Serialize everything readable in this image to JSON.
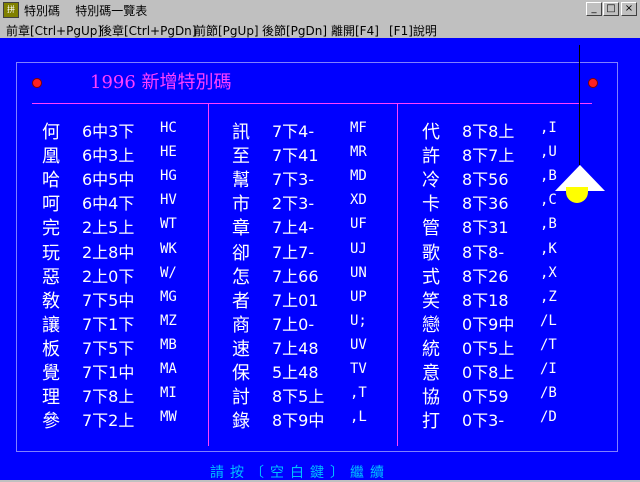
{
  "window": {
    "title": "特別碼    特別碼一覽表",
    "icon": "app-icon",
    "buttons": [
      "_",
      "□",
      "×"
    ]
  },
  "menu": [
    "前章[Ctrl+PgUp]",
    "後章[Ctrl+PgDn]",
    "前節[PgUp]",
    "後節[PgDn]",
    "離開[F4]",
    "[F1]說明"
  ],
  "page": {
    "heading": "1996 新增特別碼",
    "footer": "請按〔空白鍵〕繼續"
  },
  "columns": [
    [
      {
        "char": "何",
        "pos": "6中3下",
        "code": "HC"
      },
      {
        "char": "凰",
        "pos": "6中3上",
        "code": "HE"
      },
      {
        "char": "哈",
        "pos": "6中5中",
        "code": "HG"
      },
      {
        "char": "呵",
        "pos": "6中4下",
        "code": "HV"
      },
      {
        "char": "完",
        "pos": "2上5上",
        "code": "WT"
      },
      {
        "char": "玩",
        "pos": "2上8中",
        "code": "WK"
      },
      {
        "char": "惡",
        "pos": "2上0下",
        "code": "W/"
      },
      {
        "char": "敎",
        "pos": "7下5中",
        "code": "MG"
      },
      {
        "char": "讓",
        "pos": "7下1下",
        "code": "MZ"
      },
      {
        "char": "板",
        "pos": "7下5下",
        "code": "MB"
      },
      {
        "char": "覺",
        "pos": "7下1中",
        "code": "MA"
      },
      {
        "char": "理",
        "pos": "7下8上",
        "code": "MI"
      },
      {
        "char": "參",
        "pos": "7下2上",
        "code": "MW"
      }
    ],
    [
      {
        "char": "訊",
        "pos": "7下4-",
        "code": "MF"
      },
      {
        "char": "至",
        "pos": "7下41",
        "code": "MR"
      },
      {
        "char": "幫",
        "pos": "7下3-",
        "code": "MD"
      },
      {
        "char": "市",
        "pos": "2下3-",
        "code": "XD"
      },
      {
        "char": "章",
        "pos": "7上4-",
        "code": "UF"
      },
      {
        "char": "卻",
        "pos": "7上7-",
        "code": "UJ"
      },
      {
        "char": "怎",
        "pos": "7上66",
        "code": "UN"
      },
      {
        "char": "者",
        "pos": "7上01",
        "code": "UP"
      },
      {
        "char": "商",
        "pos": "7上0-",
        "code": "U;"
      },
      {
        "char": "速",
        "pos": "7上48",
        "code": "UV"
      },
      {
        "char": "保",
        "pos": "5上48",
        "code": "TV"
      },
      {
        "char": "討",
        "pos": "8下5上",
        "code": ",T"
      },
      {
        "char": "錄",
        "pos": "8下9中",
        "code": ",L"
      }
    ],
    [
      {
        "char": "代",
        "pos": "8下8上",
        "code": ",I"
      },
      {
        "char": "許",
        "pos": "8下7上",
        "code": ",U"
      },
      {
        "char": "冷",
        "pos": "8下56",
        "code": ",B"
      },
      {
        "char": "卡",
        "pos": "8下36",
        "code": ",C"
      },
      {
        "char": "管",
        "pos": "8下31",
        "code": ",B"
      },
      {
        "char": "歌",
        "pos": "8下8-",
        "code": ",K"
      },
      {
        "char": "式",
        "pos": "8下26",
        "code": ",X"
      },
      {
        "char": "笑",
        "pos": "8下18",
        "code": ",Z"
      },
      {
        "char": "戀",
        "pos": "0下9中",
        "code": "/L"
      },
      {
        "char": "統",
        "pos": "0下5上",
        "code": "/T"
      },
      {
        "char": "意",
        "pos": "0下8上",
        "code": "/I"
      },
      {
        "char": "協",
        "pos": "0下59",
        "code": "/B"
      },
      {
        "char": "打",
        "pos": "0下3-",
        "code": "/D"
      }
    ]
  ],
  "colors": {
    "background": "#0000ff",
    "heading": "#ff40ff",
    "text": "#ffffff",
    "footer": "#00c0ff",
    "accent_dot": "#ff2020",
    "bulb": "#ffff00"
  }
}
